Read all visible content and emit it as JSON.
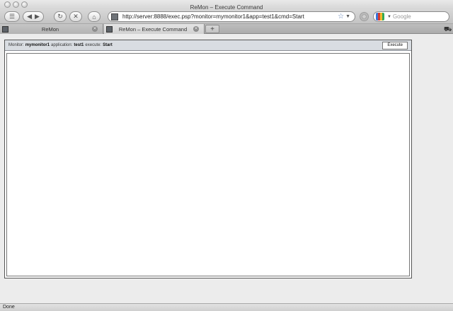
{
  "window": {
    "title": "ReMon – Execute Command"
  },
  "toolbar": {
    "url": "http://server:8888/exec.psp?monitor=mymonitor1&app=test1&cmd=Start",
    "search_placeholder": "Google"
  },
  "tabs": [
    {
      "label": "ReMon",
      "active": false
    },
    {
      "label": "ReMon – Execute Command",
      "active": true
    }
  ],
  "panel": {
    "monitor_label": "Monitor:",
    "monitor_value": "mymonitor1",
    "app_label": "application:",
    "app_value": "test1",
    "execute_label": "execute:",
    "execute_value": "Start",
    "execute_button": "Execute"
  },
  "status": {
    "text": "Done"
  }
}
